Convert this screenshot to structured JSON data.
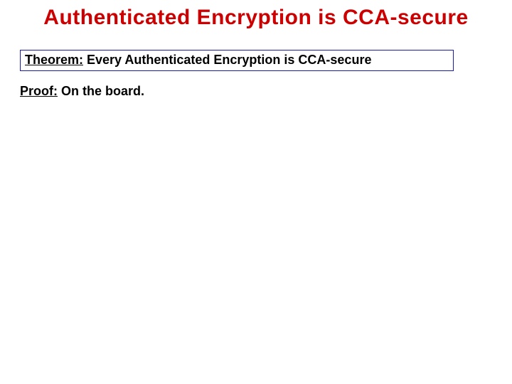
{
  "title": "Authenticated Encryption is CCA-secure",
  "theorem": {
    "label": "Theorem:",
    "text": " Every Authenticated Encryption is CCA-secure"
  },
  "proof": {
    "label": "Proof:",
    "text": " On the board."
  }
}
